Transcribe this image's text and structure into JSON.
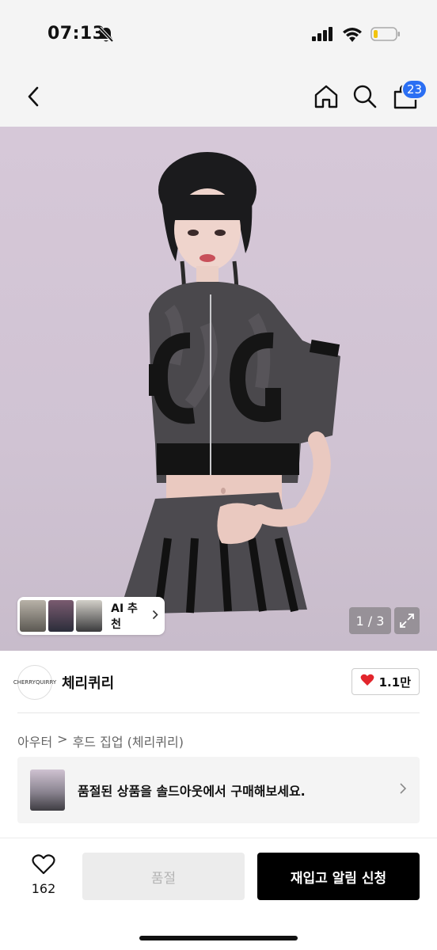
{
  "status_bar": {
    "time": "07:13",
    "icons": [
      "bell-slash-icon",
      "cellular-signal-icon",
      "wifi-icon",
      "battery-low-icon"
    ]
  },
  "nav": {
    "back_icon": "chevron-left-icon",
    "home_icon": "home-icon",
    "search_icon": "search-icon",
    "bag_icon": "shopping-bag-icon",
    "bag_count": "23"
  },
  "hero": {
    "ai_label": "AI 추천",
    "page_counter": "1 / 3",
    "expand_icon": "expand-icon"
  },
  "store": {
    "name": "체리퀴리",
    "logo_text": "CHERRYQUIRRY",
    "likes": "1.1만"
  },
  "breadcrumb": {
    "category": "아우터",
    "separator": ">",
    "subcategory": "후드 집업 (체리퀴리)"
  },
  "soldout_banner": {
    "text": "품절된 상품을 솔드아웃에서 구매해보세요."
  },
  "bottom_bar": {
    "wish_count": "162",
    "soldout_label": "품절",
    "restock_label": "재입고 알림 신청"
  },
  "colors": {
    "accent_badge": "#2b6ff3",
    "heart": "#e2252c",
    "primary_button": "#000000",
    "disabled_button": "#ececec"
  }
}
